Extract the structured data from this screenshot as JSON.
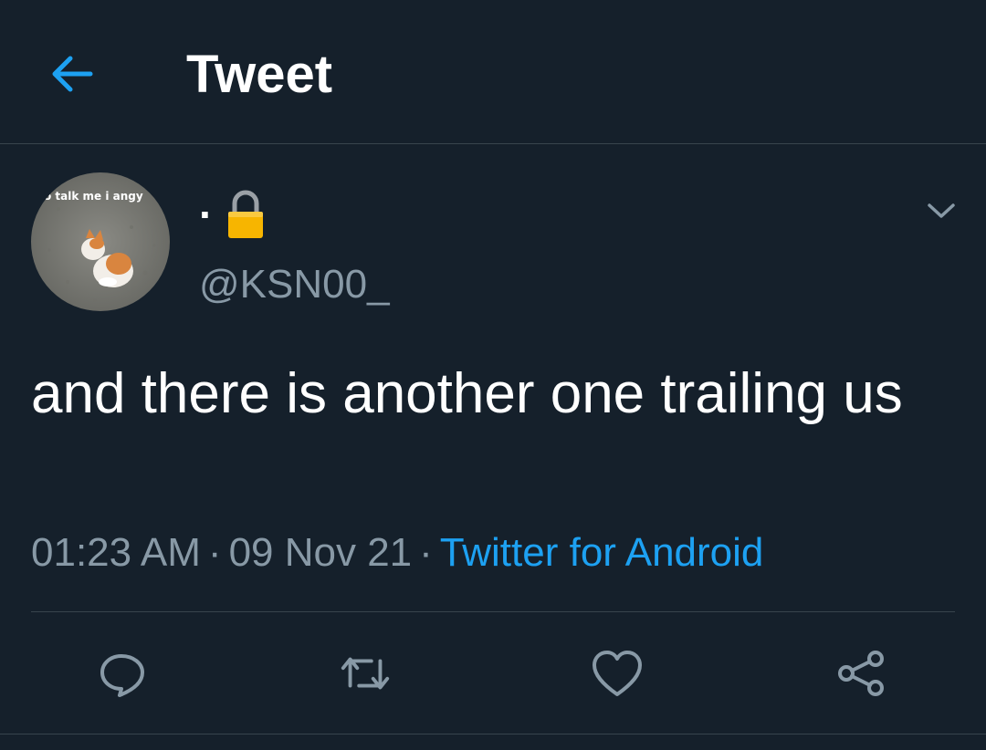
{
  "header": {
    "title": "Tweet",
    "back_icon": "arrow-left-icon"
  },
  "author": {
    "display_name": "·",
    "protected_icon": "lock-icon",
    "handle": "@KSN00_",
    "avatar_caption": "o talk me i angy",
    "avatar_icon": "kitten-photo"
  },
  "tweet": {
    "text": "and there is another one trailing us",
    "time": "01:23 AM",
    "date": "09 Nov 21",
    "separator": "·",
    "source": "Twitter for Android"
  },
  "actions": {
    "reply_icon": "reply-icon",
    "retweet_icon": "retweet-icon",
    "like_icon": "heart-icon",
    "share_icon": "share-icon",
    "more_icon": "chevron-down-icon"
  },
  "colors": {
    "background": "#15202b",
    "accent": "#1da1f2",
    "muted": "#8899a6",
    "divider": "#38444d",
    "text": "#ffffff"
  }
}
